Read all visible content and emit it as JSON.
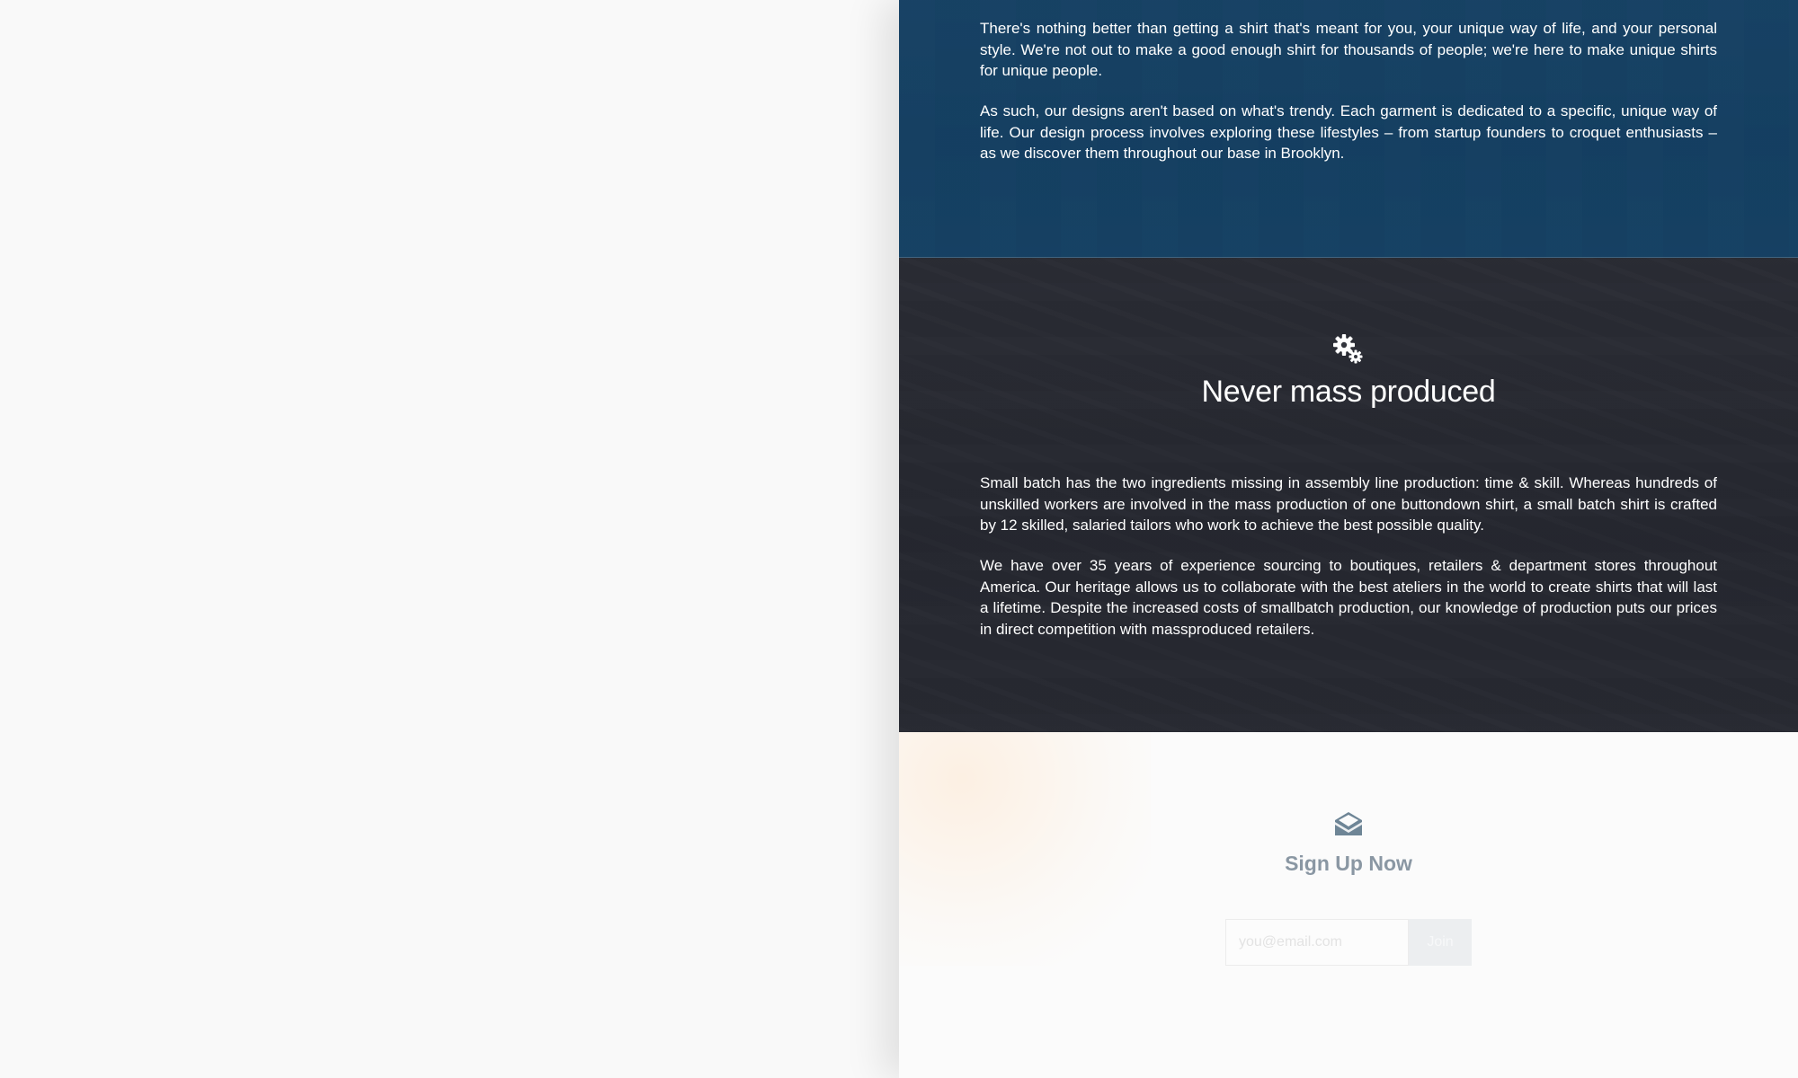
{
  "intro_section": {
    "paragraphs": [
      "There's nothing better than getting a shirt that's meant for you, your unique way of life, and your personal style. We're not out to make a good enough shirt for thousands of people; we're here to make unique shirts for unique people.",
      "As such, our designs aren't based on what's trendy. Each garment is dedicated to a specific, unique way of life. Our design process involves exploring these lifestyles – from startup founders to croquet enthusiasts – as we discover them throughout our base in Brooklyn."
    ]
  },
  "production_section": {
    "icon": "gears-icon",
    "title": "Never mass produced",
    "paragraphs": [
      "Small batch has the two ingredients missing in assembly line production: time & skill. Whereas hundreds of unskilled workers are involved in the mass production of one buttondown shirt, a small batch shirt is crafted by 12 skilled, salaried tailors who work to achieve the best possible quality.",
      "We have over 35 years of experience sourcing to boutiques, retailers & department stores throughout America. Our heritage allows us to collaborate with the best ateliers in the world to create shirts that will last a lifetime. Despite the increased costs of smallbatch production, our knowledge of production puts our prices in direct competition with massproduced retailers."
    ]
  },
  "signup": {
    "icon": "envelope-open-icon",
    "title": "Sign Up Now",
    "email_placeholder": "you@email.com",
    "email_value": "",
    "join_label": "Join"
  },
  "colors": {
    "blue_overlay": "#143e60",
    "dark_overlay": "#24262e",
    "signup_text": "#8a97a3",
    "page_bg": "#f9f9f9"
  }
}
